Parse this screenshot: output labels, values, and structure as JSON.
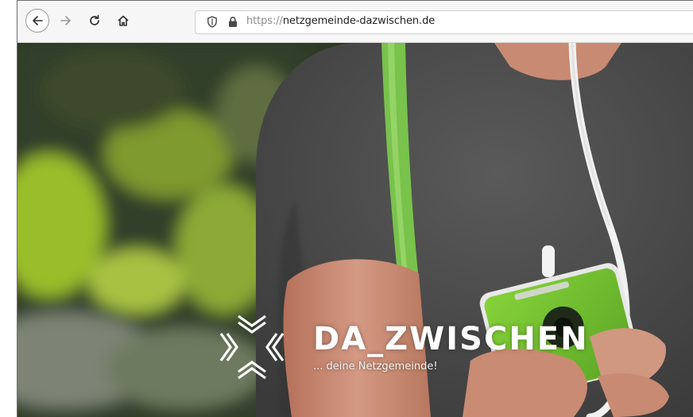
{
  "browser": {
    "url_protocol": "https://",
    "url_host": "netzgemeinde-dazwischen.de",
    "icons": [
      "back-arrow-icon",
      "forward-arrow-icon",
      "reload-icon",
      "home-icon",
      "shield-icon",
      "lock-icon"
    ]
  },
  "hero": {
    "brand_title": "DA_ZWISCHEN",
    "brand_subtitle": "... deine Netzgemeinde!",
    "logo_icon": "chevron-cross-logo-icon",
    "colors": {
      "phone_green": "#7ccc2e",
      "strap_green": "#7fc94a",
      "shirt_gray": "#4a4a4a"
    }
  }
}
